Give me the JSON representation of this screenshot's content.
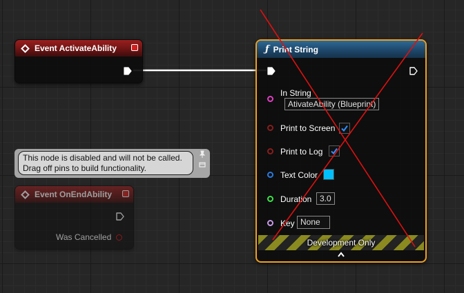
{
  "event_activate": {
    "title": "Event ActivateAbility"
  },
  "print_string": {
    "title": "Print String",
    "function_icon": "function-icon",
    "pins": {
      "in_string": {
        "label": "In String",
        "value": "AtivateAbility (Blueprint)",
        "color": "#e040c0"
      },
      "print_to_screen": {
        "label": "Print to Screen",
        "checked": true,
        "color": "#8a1d1d"
      },
      "print_to_log": {
        "label": "Print to Log",
        "checked": true,
        "color": "#8a1d1d"
      },
      "text_color": {
        "label": "Text Color",
        "swatch": "#00bfff",
        "color": "#2a7ae0"
      },
      "duration": {
        "label": "Duration",
        "value": "3.0",
        "color": "#3ee24a"
      },
      "key": {
        "label": "Key",
        "value": "None",
        "color": "#c89be8"
      }
    },
    "footer": "Development Only",
    "selected_border": "#f0a020"
  },
  "event_end": {
    "title": "Event OnEndAbility",
    "was_cancelled": "Was Cancelled"
  },
  "tooltip": {
    "line1": "This node is disabled and will not be called.",
    "line2": "Drag off pins to build functionality."
  },
  "colors": {
    "graph_bg": "#262626",
    "event_header": "#9a1f1f",
    "function_header": "#1f4a6e",
    "strike_line": "#e01010"
  }
}
